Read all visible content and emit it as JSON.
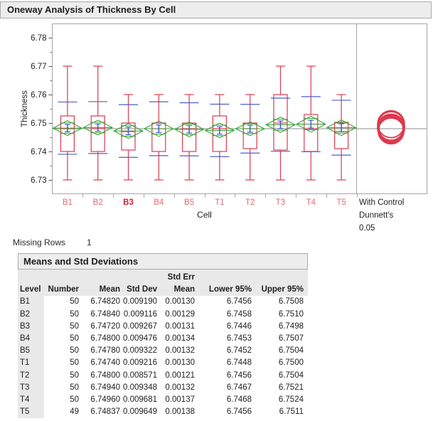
{
  "header": {
    "title": "Oneway Analysis of Thickness By Cell"
  },
  "chart_data": {
    "type": "oneway-boxplot-with-comparison-circles",
    "title": "Oneway Analysis of Thickness By Cell",
    "xlabel": "Cell",
    "ylabel": "Thickness",
    "ylim": [
      6.73,
      6.78
    ],
    "yticks": [
      6.73,
      6.74,
      6.75,
      6.76,
      6.77,
      6.78
    ],
    "grid": false,
    "legend_position": "none",
    "grand_mean": 6.748,
    "control_group": "B3",
    "comparison_label_lines": [
      "With Control",
      "Dunnett's",
      "0.05"
    ],
    "groups": [
      {
        "level": "B1",
        "number": 50,
        "mean": 6.7482,
        "std_dev": 0.00919,
        "std_err_mean": 0.0013,
        "lower95": 6.7456,
        "upper95": 6.7508,
        "whisker_low": 6.73,
        "q1": 6.74,
        "median": 6.748,
        "q3": 6.7525,
        "whisker_high": 6.77
      },
      {
        "level": "B2",
        "number": 50,
        "mean": 6.7484,
        "std_dev": 0.009116,
        "std_err_mean": 0.00129,
        "lower95": 6.7458,
        "upper95": 6.751,
        "whisker_low": 6.73,
        "q1": 6.74,
        "median": 6.748,
        "q3": 6.7525,
        "whisker_high": 6.77
      },
      {
        "level": "B3",
        "number": 50,
        "mean": 6.7472,
        "std_dev": 0.009267,
        "std_err_mean": 0.00131,
        "lower95": 6.7446,
        "upper95": 6.7498,
        "whisker_low": 6.73,
        "q1": 6.7405,
        "median": 6.747,
        "q3": 6.75,
        "whisker_high": 6.76
      },
      {
        "level": "B4",
        "number": 50,
        "mean": 6.748,
        "std_dev": 0.009476,
        "std_err_mean": 0.00134,
        "lower95": 6.7453,
        "upper95": 6.7507,
        "whisker_low": 6.73,
        "q1": 6.74,
        "median": 6.748,
        "q3": 6.75,
        "whisker_high": 6.76
      },
      {
        "level": "B5",
        "number": 50,
        "mean": 6.7478,
        "std_dev": 0.009322,
        "std_err_mean": 0.00132,
        "lower95": 6.7452,
        "upper95": 6.7504,
        "whisker_low": 6.73,
        "q1": 6.74,
        "median": 6.748,
        "q3": 6.75,
        "whisker_high": 6.76
      },
      {
        "level": "T1",
        "number": 50,
        "mean": 6.7474,
        "std_dev": 0.009216,
        "std_err_mean": 0.0013,
        "lower95": 6.7448,
        "upper95": 6.75,
        "whisker_low": 6.73,
        "q1": 6.74,
        "median": 6.748,
        "q3": 6.7525,
        "whisker_high": 6.76
      },
      {
        "level": "T2",
        "number": 50,
        "mean": 6.748,
        "std_dev": 0.008571,
        "std_err_mean": 0.00121,
        "lower95": 6.7456,
        "upper95": 6.7504,
        "whisker_low": 6.73,
        "q1": 6.741,
        "median": 6.748,
        "q3": 6.75,
        "whisker_high": 6.76
      },
      {
        "level": "T3",
        "number": 50,
        "mean": 6.7494,
        "std_dev": 0.009348,
        "std_err_mean": 0.00132,
        "lower95": 6.7467,
        "upper95": 6.7521,
        "whisker_low": 6.73,
        "q1": 6.7405,
        "median": 6.75,
        "q3": 6.76,
        "whisker_high": 6.77
      },
      {
        "level": "T4",
        "number": 50,
        "mean": 6.7496,
        "std_dev": 0.009681,
        "std_err_mean": 0.00137,
        "lower95": 6.7468,
        "upper95": 6.7524,
        "whisker_low": 6.73,
        "q1": 6.74,
        "median": 6.748,
        "q3": 6.753,
        "whisker_high": 6.77
      },
      {
        "level": "T5",
        "number": 49,
        "mean": 6.74837,
        "std_dev": 0.009649,
        "std_err_mean": 0.00138,
        "lower95": 6.7456,
        "upper95": 6.7511,
        "whisker_low": 6.73,
        "q1": 6.741,
        "median": 6.747,
        "q3": 6.75,
        "whisker_high": 6.76
      }
    ],
    "colors": {
      "box": "#dc3a50",
      "mean_sd_marks": "#4a5fc8",
      "diamond": "#39a339",
      "grand_mean_line": "#8c8c8c",
      "tick_label_red": "#e56a73",
      "control_label_red": "#c9253a",
      "circles": "#dc3a50",
      "frame": "#a6a6a6",
      "text": "#1e1e1e"
    }
  },
  "missing_rows": {
    "label": "Missing Rows",
    "value": "1"
  },
  "table": {
    "title": "Means and Std Deviations",
    "header_line1": [
      "",
      "",
      "",
      "",
      "Std Err",
      "",
      ""
    ],
    "header_line2": [
      "Level",
      "Number",
      "Mean",
      "Std Dev",
      "Mean",
      "Lower 95%",
      "Upper 95%"
    ],
    "rows": [
      [
        "B1",
        "50",
        "6.74820",
        "0.009190",
        "0.00130",
        "6.7456",
        "6.7508"
      ],
      [
        "B2",
        "50",
        "6.74840",
        "0.009116",
        "0.00129",
        "6.7458",
        "6.7510"
      ],
      [
        "B3",
        "50",
        "6.74720",
        "0.009267",
        "0.00131",
        "6.7446",
        "6.7498"
      ],
      [
        "B4",
        "50",
        "6.74800",
        "0.009476",
        "0.00134",
        "6.7453",
        "6.7507"
      ],
      [
        "B5",
        "50",
        "6.74780",
        "0.009322",
        "0.00132",
        "6.7452",
        "6.7504"
      ],
      [
        "T1",
        "50",
        "6.74740",
        "0.009216",
        "0.00130",
        "6.7448",
        "6.7500"
      ],
      [
        "T2",
        "50",
        "6.74800",
        "0.008571",
        "0.00121",
        "6.7456",
        "6.7504"
      ],
      [
        "T3",
        "50",
        "6.74940",
        "0.009348",
        "0.00132",
        "6.7467",
        "6.7521"
      ],
      [
        "T4",
        "50",
        "6.74960",
        "0.009681",
        "0.00137",
        "6.7468",
        "6.7524"
      ],
      [
        "T5",
        "49",
        "6.74837",
        "0.009649",
        "0.00138",
        "6.7456",
        "6.7511"
      ]
    ]
  }
}
